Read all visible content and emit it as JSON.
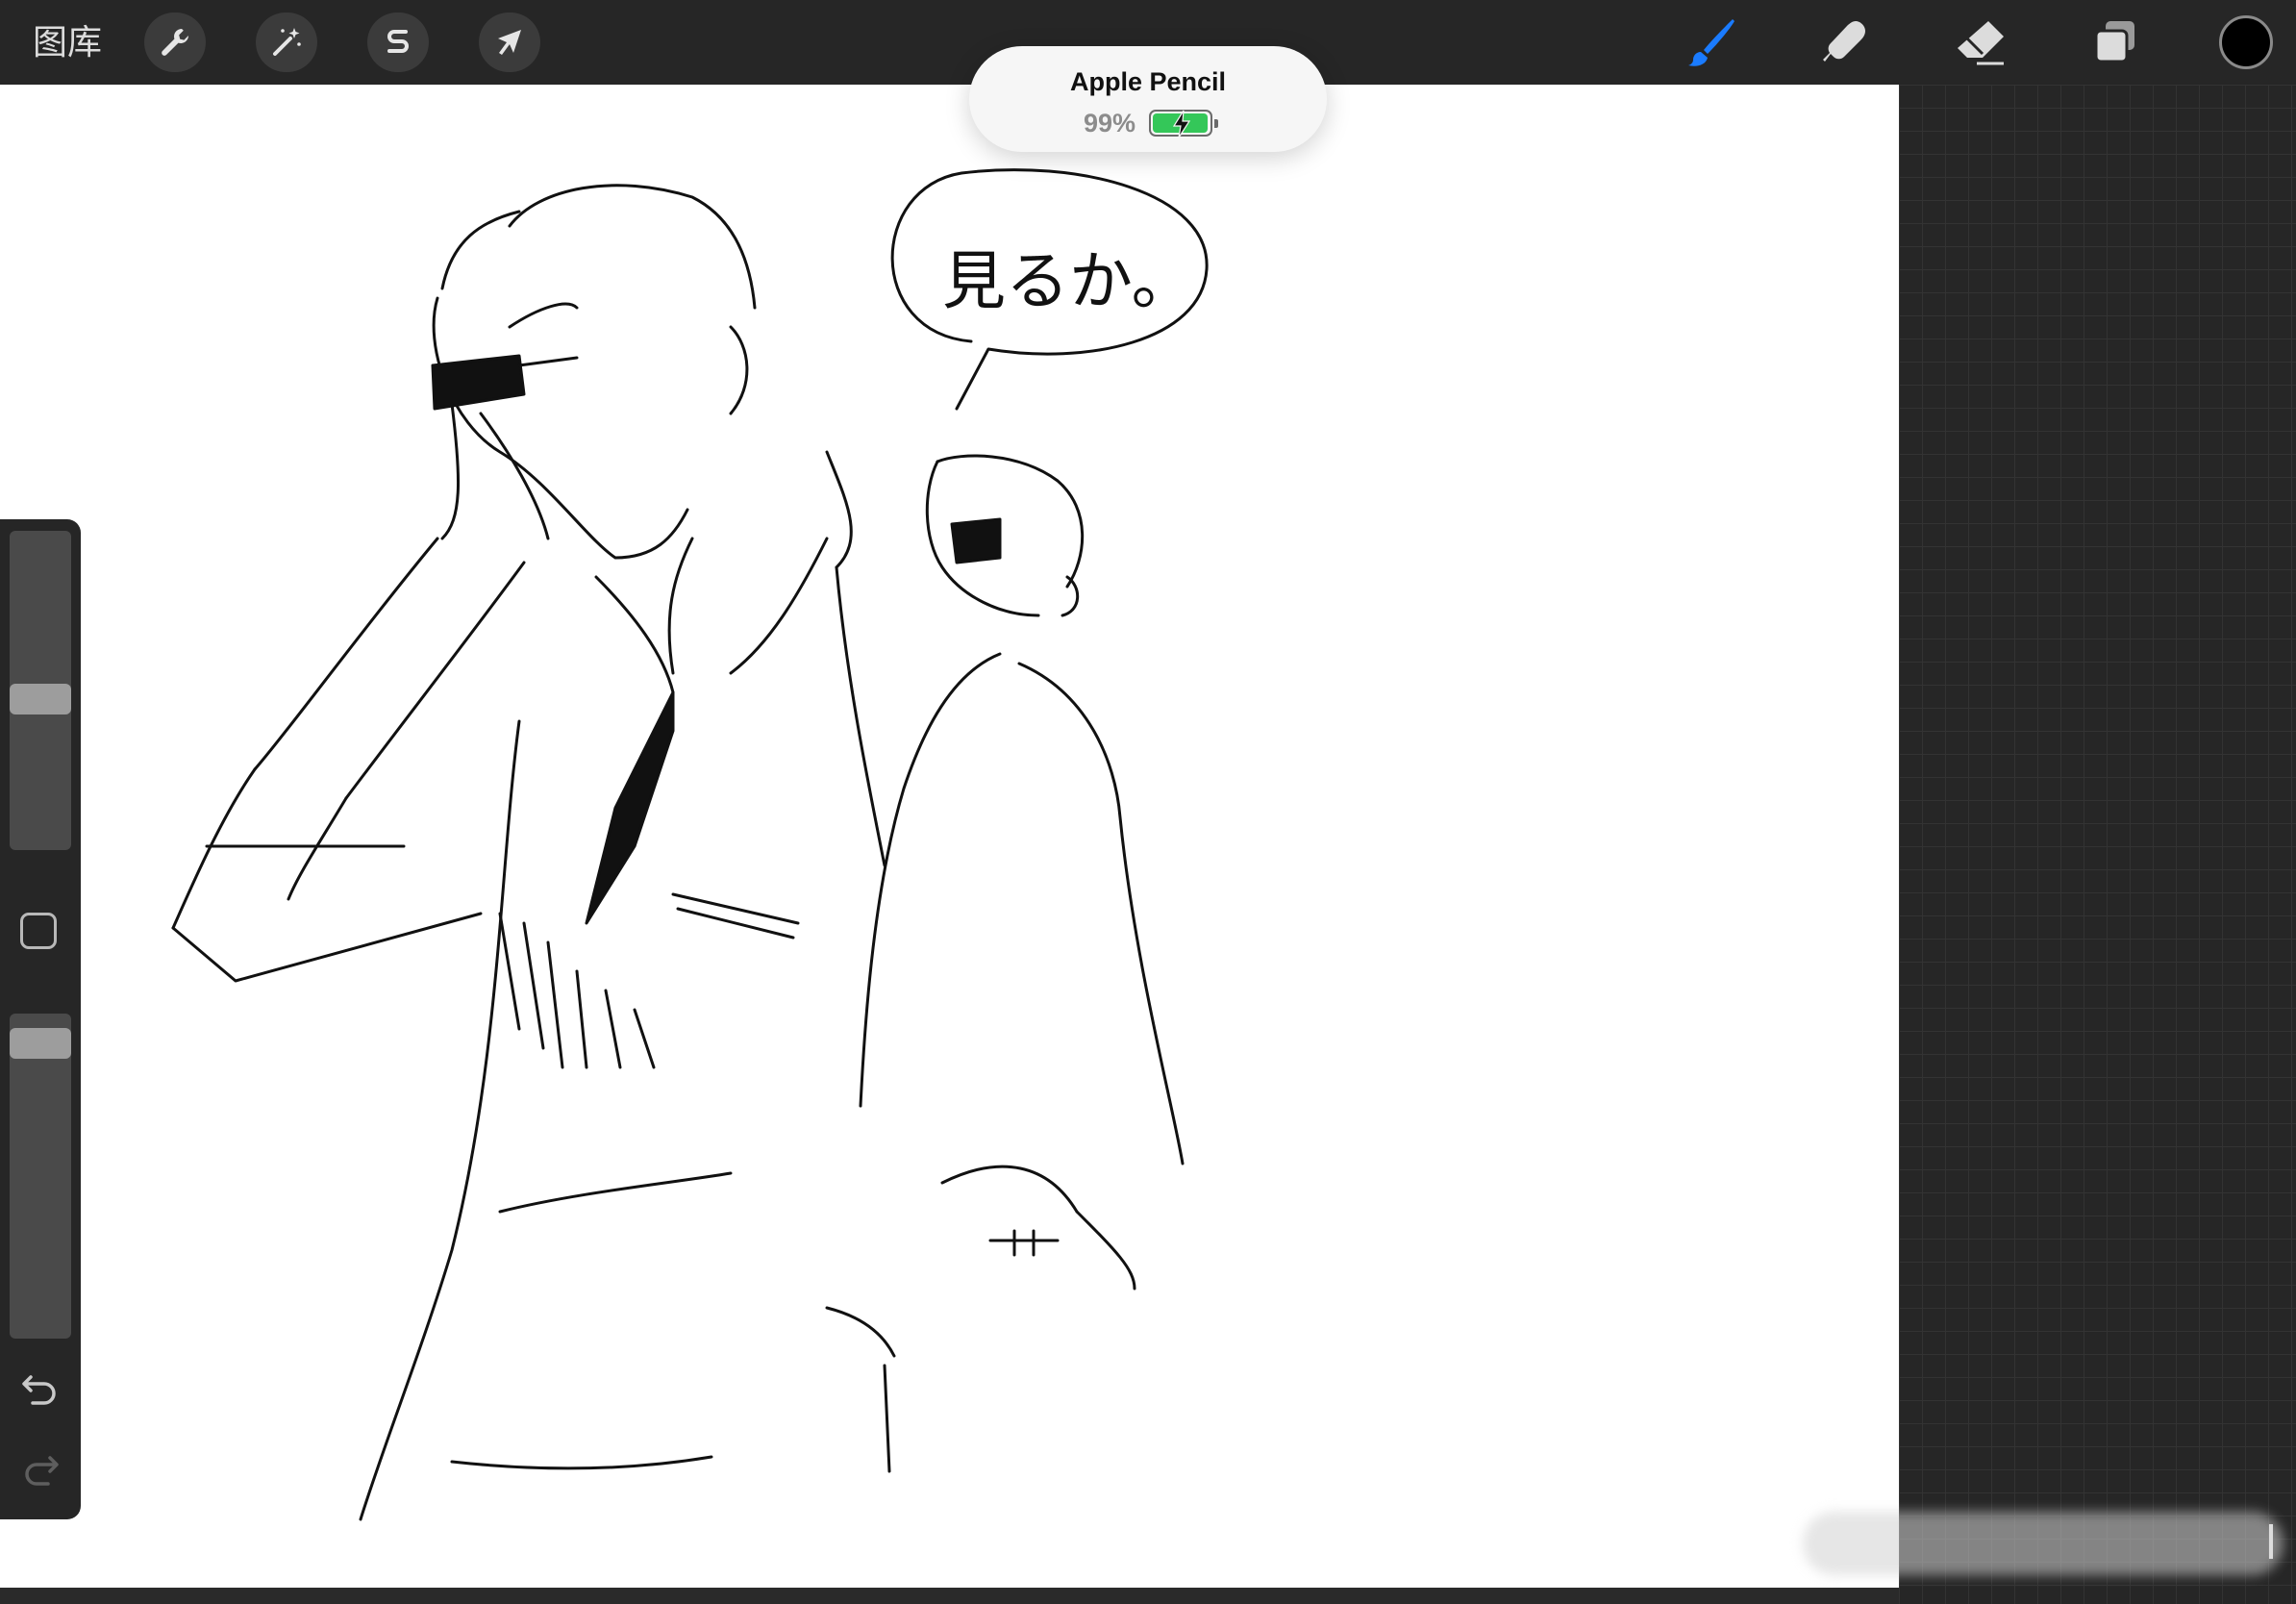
{
  "toolbar": {
    "gallery_label": "图库",
    "left_tools": [
      {
        "name": "actions",
        "icon": "wrench-icon"
      },
      {
        "name": "adjustments",
        "icon": "magic-wand-icon"
      },
      {
        "name": "selection",
        "icon": "selection-s-icon"
      },
      {
        "name": "transform",
        "icon": "arrow-cursor-icon"
      }
    ],
    "right_tools": [
      {
        "name": "brush",
        "icon": "brush-icon",
        "active": true
      },
      {
        "name": "smudge",
        "icon": "smudge-finger-icon",
        "active": false
      },
      {
        "name": "eraser",
        "icon": "eraser-icon",
        "active": false
      },
      {
        "name": "layers",
        "icon": "layers-icon",
        "active": false
      }
    ],
    "current_color": "#000000",
    "active_tool_color": "#1a7bff"
  },
  "sidebar": {
    "brush_size_level": 0.47,
    "opacity_level": 0.95,
    "modify_icon": "square-icon",
    "undo_icon": "undo-arrow-icon",
    "redo_icon": "redo-arrow-icon"
  },
  "pencil_popup": {
    "title": "Apple Pencil",
    "battery_percent": "99%",
    "battery_level": 0.99,
    "battery_color": "#34c759"
  },
  "canvas": {
    "speech_text": "見るか。"
  }
}
